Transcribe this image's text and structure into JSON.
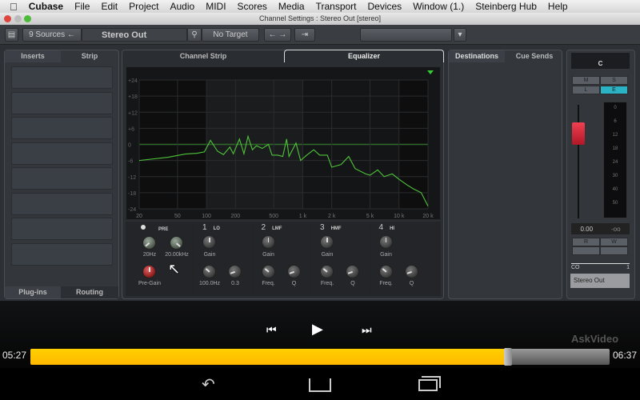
{
  "menubar": {
    "apple": "",
    "items": [
      "Cubase",
      "File",
      "Edit",
      "Project",
      "Audio",
      "MIDI",
      "Scores",
      "Media",
      "Transport",
      "Devices",
      "Window (1.)",
      "Steinberg Hub",
      "Help"
    ]
  },
  "window": {
    "title": "Channel Settings : Stereo Out [stereo]"
  },
  "toolbar": {
    "sources": "9 Sources",
    "channel": "Stereo Out",
    "target": "No Target",
    "preset": ""
  },
  "left_panel": {
    "tabs": [
      "Inserts",
      "Strip"
    ],
    "bottom_tabs": [
      "Plug-ins",
      "Routing"
    ],
    "slot_count": 8
  },
  "center_panel": {
    "tabs": [
      "Channel Strip",
      "Equalizer"
    ],
    "active_tab": "Equalizer"
  },
  "eq_display": {
    "y_ticks": [
      "+24",
      "+18",
      "+12",
      "+6",
      "0",
      "-6",
      "-12",
      "-18",
      "-24"
    ],
    "x_ticks": [
      "20",
      "50",
      "100",
      "200",
      "500",
      "1 k",
      "2 k",
      "5 k",
      "10 k",
      "20 k"
    ],
    "x_tick_values": [
      20,
      50,
      100,
      200,
      500,
      1000,
      2000,
      5000,
      10000,
      20000
    ],
    "ylim": [
      -24,
      24
    ],
    "xlim": [
      20,
      20000
    ],
    "curve_color": "#4fc43a",
    "spectrum": [
      [
        20,
        -6
      ],
      [
        40,
        -4.8
      ],
      [
        60,
        -3.6
      ],
      [
        80,
        -3.3
      ],
      [
        95,
        -2.8
      ],
      [
        110,
        1.5
      ],
      [
        130,
        -2.5
      ],
      [
        150,
        -3.8
      ],
      [
        175,
        -1
      ],
      [
        190,
        -3.5
      ],
      [
        220,
        2
      ],
      [
        245,
        -3.5
      ],
      [
        270,
        3
      ],
      [
        300,
        -2
      ],
      [
        330,
        -0.5
      ],
      [
        380,
        -1.5
      ],
      [
        440,
        0
      ],
      [
        480,
        -4
      ],
      [
        550,
        -4
      ],
      [
        620,
        -4.5
      ],
      [
        680,
        2
      ],
      [
        720,
        -4.5
      ],
      [
        850,
        0.5
      ],
      [
        950,
        -6
      ],
      [
        1100,
        -4
      ],
      [
        1300,
        -2
      ],
      [
        1500,
        -4
      ],
      [
        1800,
        -4
      ],
      [
        2000,
        -8.5
      ],
      [
        2500,
        -7.5
      ],
      [
        3000,
        -4.5
      ],
      [
        3500,
        -9
      ],
      [
        4500,
        -11
      ],
      [
        5000,
        -11.5
      ],
      [
        6000,
        -9.5
      ],
      [
        7000,
        -12
      ],
      [
        8500,
        -11
      ],
      [
        10000,
        -13
      ],
      [
        12000,
        -15
      ],
      [
        14000,
        -16.5
      ],
      [
        17000,
        -18
      ],
      [
        20000,
        -23
      ]
    ]
  },
  "eq_controls": {
    "pre": {
      "label": "PRE",
      "lowcut": "20Hz",
      "highcut": "20.00kHz",
      "pregain": "Pre-Gain"
    },
    "bands": [
      {
        "num": "1",
        "name": "LO",
        "gain": "Gain",
        "freq": "100.0Hz",
        "q": "0.3"
      },
      {
        "num": "2",
        "name": "LMF",
        "gain": "Gain",
        "freq": "Freq.",
        "q": "Q"
      },
      {
        "num": "3",
        "name": "HMF",
        "gain": "Gain",
        "freq": "Freq.",
        "q": "Q"
      },
      {
        "num": "4",
        "name": "HI",
        "gain": "Gain",
        "freq": "Freq.",
        "q": "Q"
      }
    ]
  },
  "right_panel": {
    "tabs": [
      "Destinations",
      "Cue Sends"
    ]
  },
  "strip": {
    "pan": "C",
    "buttons": [
      "M",
      "S",
      "L",
      "E",
      "R",
      "W"
    ],
    "meter_scale": [
      "0",
      "6",
      "12",
      "18",
      "24",
      "30",
      "40",
      "50"
    ],
    "volume": "0.00",
    "peak": "-oo",
    "link_icon": "CO",
    "number": "1",
    "name": "Stereo Out",
    "accent": "#2ab3c4"
  },
  "player": {
    "elapsed": "05:27",
    "total": "06:37",
    "progress": 0.824,
    "watermark": "AskVideo",
    "accent": "#ffc200"
  }
}
